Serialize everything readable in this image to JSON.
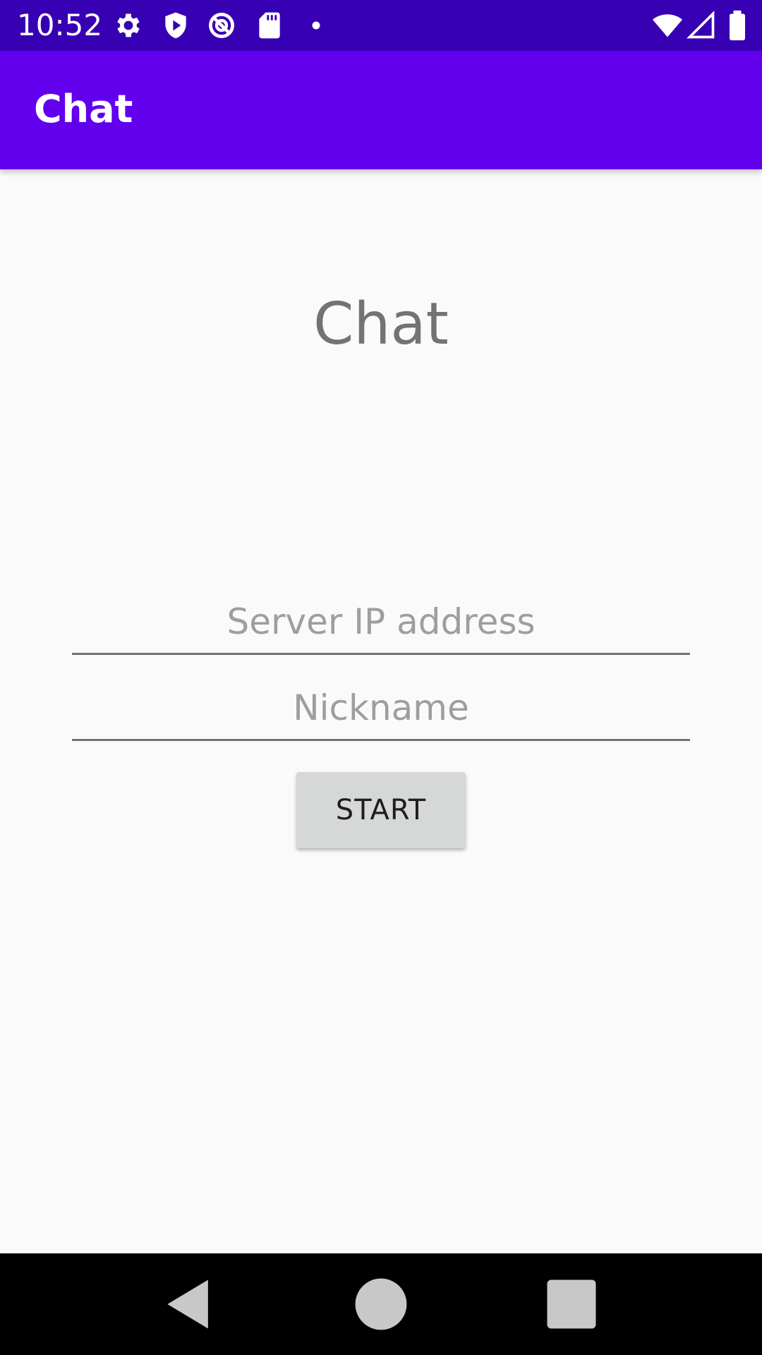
{
  "status_bar": {
    "time": "10:52",
    "left_icons": [
      "settings-icon",
      "shield-icon",
      "data-saver-icon",
      "sd-card-icon",
      "dot-icon"
    ],
    "right_icons": [
      "wifi-icon",
      "cell-signal-icon",
      "battery-icon"
    ]
  },
  "app_bar": {
    "title": "Chat"
  },
  "main": {
    "heading": "Chat",
    "server_ip_field": {
      "value": "",
      "placeholder": "Server IP address"
    },
    "nickname_field": {
      "value": "",
      "placeholder": "Nickname"
    },
    "start_button_label": "START"
  },
  "nav_bar": {
    "buttons": [
      "back-icon",
      "home-icon",
      "recents-icon"
    ]
  },
  "colors": {
    "status_bar": "#3700b3",
    "app_bar": "#6200ee",
    "background": "#fafafa",
    "heading_text": "#737373",
    "button": "#d6d7d7",
    "nav_bar": "#000000"
  }
}
